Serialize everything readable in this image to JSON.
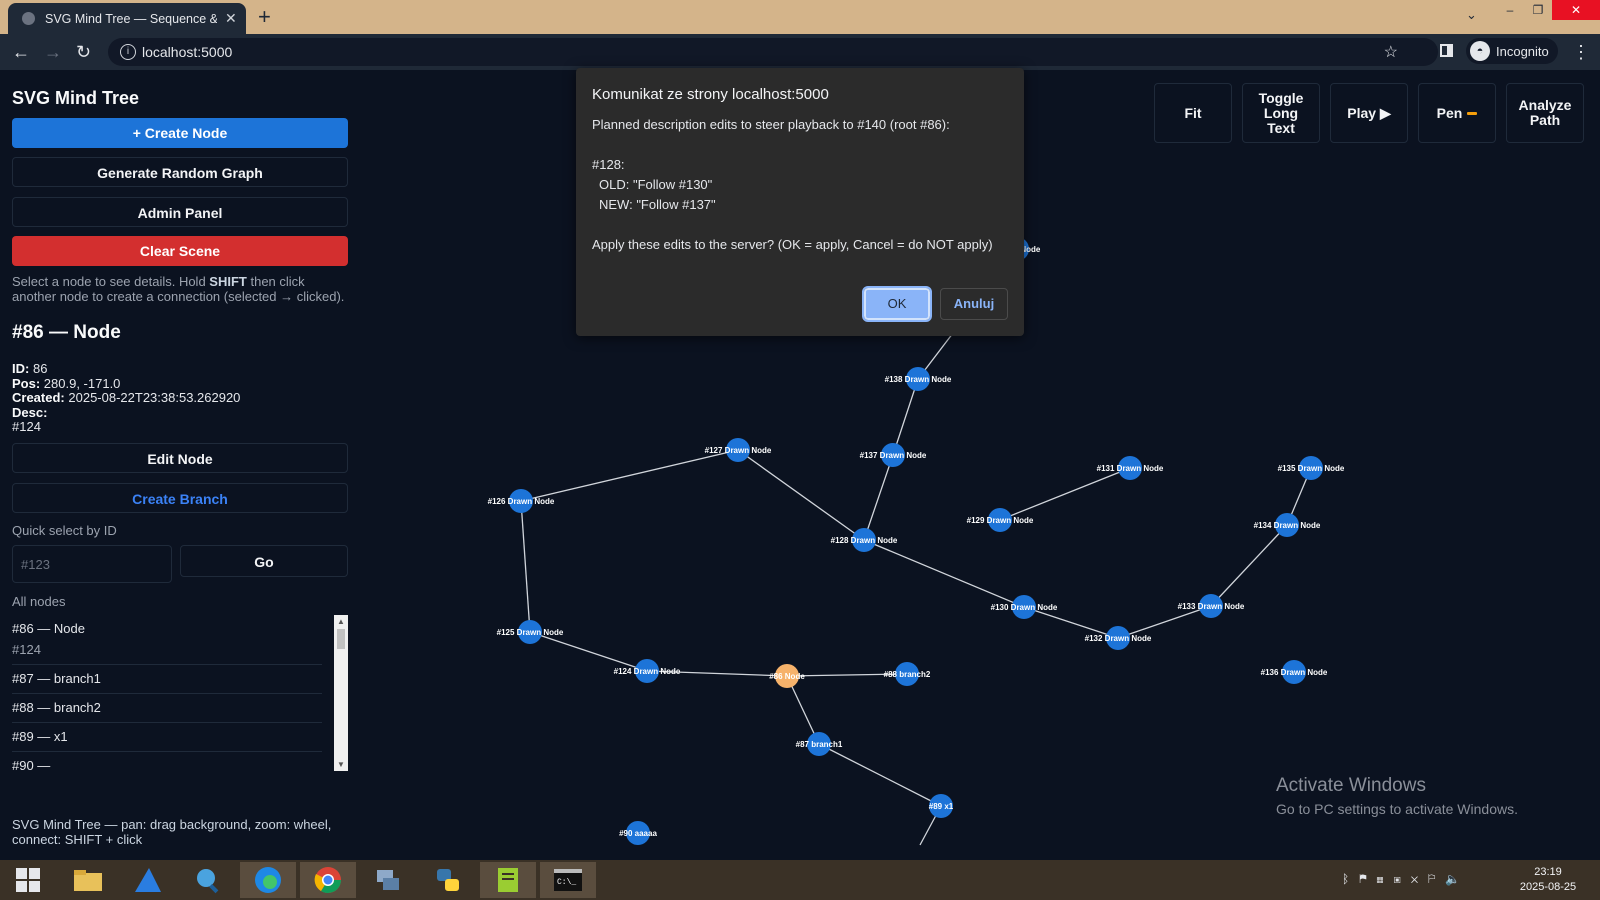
{
  "browser": {
    "tab_title": "SVG Mind Tree — Sequence & Br",
    "url": "localhost:5000",
    "profile_label": "Incognito"
  },
  "sidebar": {
    "title": "SVG Mind Tree",
    "create_node": "+ Create Node",
    "generate_random": "Generate Random Graph",
    "admin_panel": "Admin Panel",
    "clear_scene": "Clear Scene",
    "hint_pre": "Select a node to see details. Hold ",
    "hint_key": "SHIFT",
    "hint_post": " then click another node to create a connection (selected → clicked).",
    "selected_title": "#86 — Node",
    "details": {
      "id_label": "ID:",
      "id_value": "86",
      "pos_label": "Pos:",
      "pos_value": "280.9, -171.0",
      "created_label": "Created:",
      "created_value": "2025-08-22T23:38:53.262920",
      "desc_label": "Desc:",
      "desc_value": "#124"
    },
    "edit_node": "Edit Node",
    "create_branch": "Create Branch",
    "quick_select_label": "Quick select by ID",
    "quick_select_placeholder": "#123",
    "go": "Go",
    "all_nodes_label": "All nodes",
    "node_list": [
      {
        "label": "#86 — Node",
        "sub": "#124"
      },
      {
        "label": "#87 — branch1",
        "sub": ""
      },
      {
        "label": "#88 — branch2",
        "sub": ""
      },
      {
        "label": "#89 — x1",
        "sub": ""
      },
      {
        "label": "#90 —",
        "sub": ""
      }
    ],
    "footer_hint": "SVG Mind Tree — pan: drag background, zoom: wheel, connect: SHIFT + click"
  },
  "toolbar": {
    "fit": "Fit",
    "toggle_long_text": "Toggle Long Text",
    "play": "Play ▶",
    "pen": "Pen",
    "analyze_path": "Analyze Path"
  },
  "graph": {
    "node_color": "#1d74d8",
    "selected_color": "#f6b26b",
    "edge_color": "#d1d5db",
    "nodes": [
      {
        "id": "n86",
        "label": "#86 Node",
        "selected": true
      },
      {
        "id": "n87",
        "label": "#87 branch1"
      },
      {
        "id": "n88",
        "label": "#88 branch2"
      },
      {
        "id": "n89",
        "label": "#89 x1"
      },
      {
        "id": "n90",
        "label": "#90 aaaaa"
      },
      {
        "id": "n124",
        "label": "#124 Drawn Node"
      },
      {
        "id": "n125",
        "label": "#125 Drawn Node"
      },
      {
        "id": "n126",
        "label": "#126 Drawn Node"
      },
      {
        "id": "n127",
        "label": "#127 Drawn Node"
      },
      {
        "id": "n128",
        "label": "#128 Drawn Node"
      },
      {
        "id": "n129",
        "label": "#129 Drawn Node"
      },
      {
        "id": "n130",
        "label": "#130 Drawn Node"
      },
      {
        "id": "n131",
        "label": "#131 Drawn Node"
      },
      {
        "id": "n132",
        "label": "#132 Drawn Node"
      },
      {
        "id": "n133",
        "label": "#133 Drawn Node"
      },
      {
        "id": "n134",
        "label": "#134 Drawn Node"
      },
      {
        "id": "n135",
        "label": "#135 Drawn Node"
      },
      {
        "id": "n136",
        "label": "#136 Drawn Node"
      },
      {
        "id": "n137",
        "label": "#137 Drawn Node"
      },
      {
        "id": "n138",
        "label": "#138 Drawn Node"
      },
      {
        "id": "n139",
        "label": "Drawn Node"
      }
    ],
    "edges": [
      [
        "n86",
        "n124"
      ],
      [
        "n86",
        "n88"
      ],
      [
        "n86",
        "n87"
      ],
      [
        "n87",
        "n89"
      ],
      [
        "n124",
        "n125"
      ],
      [
        "n125",
        "n126"
      ],
      [
        "n126",
        "n127"
      ],
      [
        "n127",
        "n128"
      ],
      [
        "n128",
        "n137"
      ],
      [
        "n137",
        "n138"
      ],
      [
        "n138",
        "n139"
      ],
      [
        "n128",
        "n130"
      ],
      [
        "n130",
        "n132"
      ],
      [
        "n132",
        "n133"
      ],
      [
        "n133",
        "n134"
      ],
      [
        "n134",
        "n135"
      ],
      [
        "n129",
        "n131"
      ],
      [
        "n89",
        "n_off"
      ]
    ]
  },
  "dialog": {
    "title": "Komunikat ze strony localhost:5000",
    "line1": "Planned description edits to steer playback to #140 (root #86):",
    "line2": "#128:",
    "line3": "OLD: \"Follow #130\"",
    "line4": "NEW: \"Follow #137\"",
    "line5": "Apply these edits to the server? (OK = apply, Cancel = do NOT apply)",
    "ok": "OK",
    "cancel": "Anuluj"
  },
  "watermark": {
    "line1": "Activate Windows",
    "line2": "Go to PC settings to activate Windows."
  },
  "taskbar": {
    "time": "23:19",
    "date": "2025-08-25"
  }
}
